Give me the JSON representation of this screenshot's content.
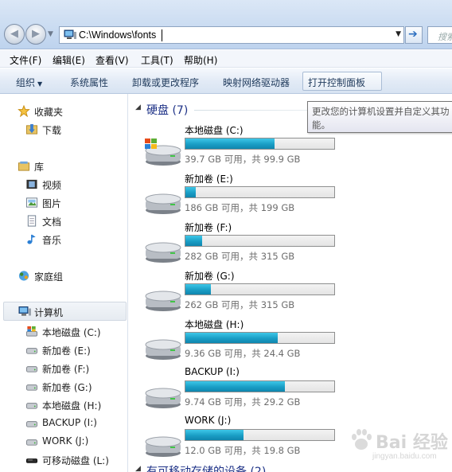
{
  "address": {
    "path": "C:\\Windows\\fonts",
    "search_placeholder": "搜索"
  },
  "menubar": [
    {
      "label": "文件(F)"
    },
    {
      "label": "编辑(E)"
    },
    {
      "label": "查看(V)"
    },
    {
      "label": "工具(T)"
    },
    {
      "label": "帮助(H)"
    }
  ],
  "toolbar": {
    "organize": "组织",
    "system_properties": "系统属性",
    "uninstall": "卸载或更改程序",
    "map_drive": "映射网络驱动器",
    "control_panel": "打开控制面板"
  },
  "tooltip": "更改您的计算机设置并自定义其功能。",
  "nav": {
    "favorites": "收藏夹",
    "downloads": "下载",
    "libraries": "库",
    "videos": "视频",
    "pictures": "图片",
    "documents": "文档",
    "music": "音乐",
    "homegroup": "家庭组",
    "computer": "计算机",
    "drives": [
      {
        "label": "本地磁盘 (C:)",
        "icon": "windows-drive-icon"
      },
      {
        "label": "新加卷 (E:)",
        "icon": "drive-icon"
      },
      {
        "label": "新加卷 (F:)",
        "icon": "drive-icon"
      },
      {
        "label": "新加卷 (G:)",
        "icon": "drive-icon"
      },
      {
        "label": "本地磁盘 (H:)",
        "icon": "drive-icon"
      },
      {
        "label": "BACKUP (I:)",
        "icon": "drive-icon"
      },
      {
        "label": "WORK (J:)",
        "icon": "drive-icon"
      },
      {
        "label": "可移动磁盘 (L:)",
        "icon": "removable-drive-icon"
      }
    ]
  },
  "content": {
    "hard_disks_header": "硬盘 (7)",
    "removable_header": "有可移动存储的设备 (2)",
    "drives": [
      {
        "name": "本地磁盘 (C:)",
        "info": "39.7 GB 可用，共 99.9 GB",
        "used_fraction": 0.6,
        "icon": "windows-drive-icon"
      },
      {
        "name": "新加卷 (E:)",
        "info": "186 GB 可用，共 199 GB",
        "used_fraction": 0.07,
        "icon": "drive-icon"
      },
      {
        "name": "新加卷 (F:)",
        "info": "282 GB 可用，共 315 GB",
        "used_fraction": 0.11,
        "icon": "drive-icon"
      },
      {
        "name": "新加卷 (G:)",
        "info": "262 GB 可用，共 315 GB",
        "used_fraction": 0.17,
        "icon": "drive-icon"
      },
      {
        "name": "本地磁盘 (H:)",
        "info": "9.36 GB 可用，共 24.4 GB",
        "used_fraction": 0.62,
        "icon": "drive-icon"
      },
      {
        "name": "BACKUP (I:)",
        "info": "9.74 GB 可用，共 29.2 GB",
        "used_fraction": 0.67,
        "icon": "drive-icon"
      },
      {
        "name": "WORK (J:)",
        "info": "12.0 GB 可用，共 19.8 GB",
        "used_fraction": 0.39,
        "icon": "drive-icon"
      }
    ]
  },
  "watermark": {
    "text": "Bai 经验",
    "sub": "jingyan.baidu.com"
  }
}
